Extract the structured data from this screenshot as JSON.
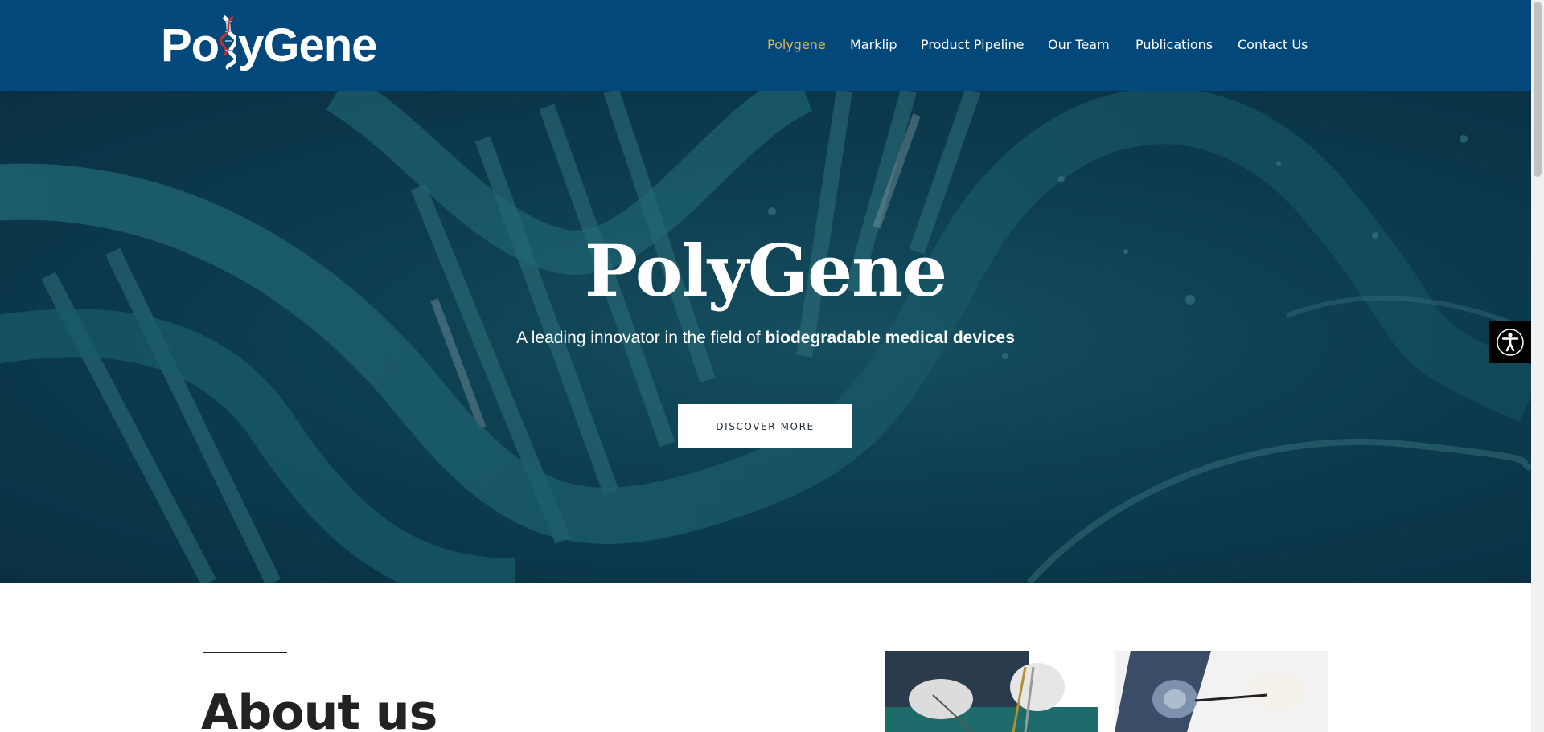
{
  "header": {
    "logo_text": "PolyGene",
    "nav": [
      {
        "label": "Polygene",
        "active": true
      },
      {
        "label": "Marklip",
        "active": false
      },
      {
        "label": "Product Pipeline",
        "active": false
      },
      {
        "label": "Our Team",
        "active": false
      },
      {
        "label": "Publications",
        "active": false
      },
      {
        "label": "Contact Us",
        "active": false
      }
    ]
  },
  "hero": {
    "title": "PolyGene",
    "subtitle_prefix": "A leading innovator in the field of ",
    "subtitle_bold": "biodegradable medical devices",
    "button_label": "DISCOVER MORE"
  },
  "about": {
    "title": "About us"
  },
  "colors": {
    "header_bg": "#03487a",
    "nav_active": "#e2b651",
    "hero_bg": "#0f4558"
  },
  "icons": {
    "accessibility": "accessibility-icon"
  }
}
